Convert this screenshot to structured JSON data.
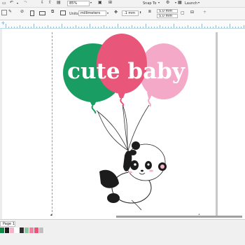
{
  "toolbar": {
    "zoom_value": "85%",
    "snap_label": "Snap To",
    "launch_label": "Launch",
    "units_label": "Units:",
    "units_value": "millimeters",
    "nudge_value": ".1 mm",
    "dup_x": "5.0 mm",
    "dup_y": "5.0 mm"
  },
  "artwork": {
    "headline": "cute baby",
    "balloon_colors": [
      "#1a9d63",
      "#e8567a",
      "#f4a9c9"
    ]
  },
  "page_tab": {
    "label": "Page 1"
  },
  "palette": [
    "#0e8a46",
    "#1c1c1c",
    "#f6b3c8",
    "#ffffff",
    "#2e2e2e",
    "#8fc7a3",
    "#f081a0",
    "#e8567a",
    "#bfbfbf"
  ],
  "icons": {
    "zoom_icon": "zoom-icon",
    "settings_icon": "gear-icon"
  }
}
